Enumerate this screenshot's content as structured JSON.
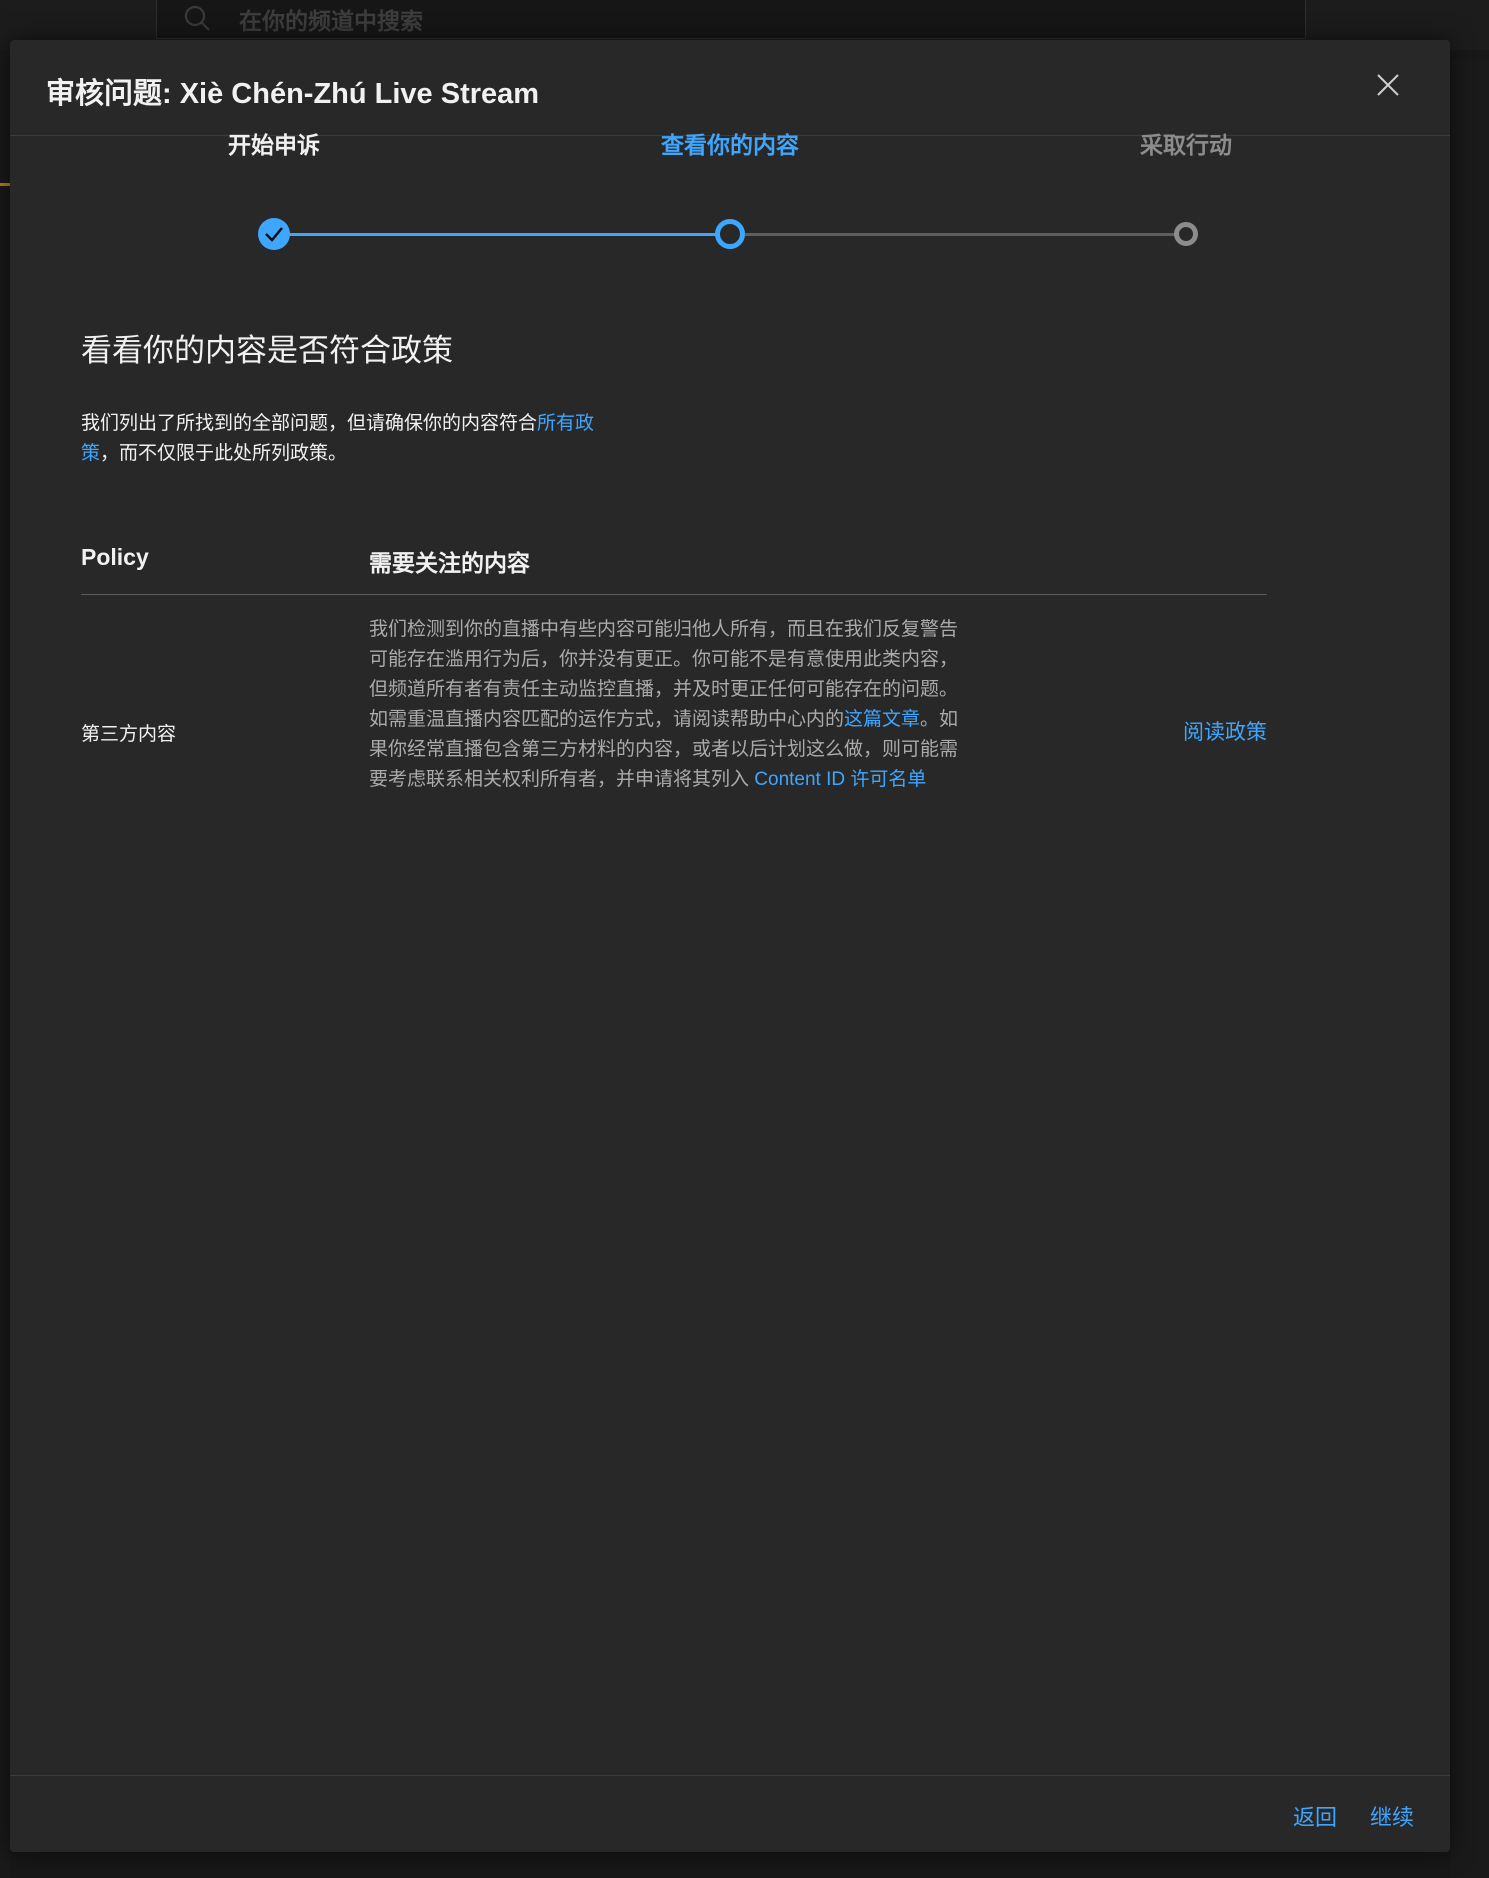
{
  "background": {
    "search_placeholder": "在你的频道中搜索"
  },
  "modal": {
    "title": "审核问题: Xiè Chén-Zhú Live Stream",
    "steps": [
      {
        "label": "开始申诉",
        "state": "done"
      },
      {
        "label": "查看你的内容",
        "state": "current"
      },
      {
        "label": "采取行动",
        "state": "todo"
      }
    ],
    "heading": "看看你的内容是否符合政策",
    "intro": {
      "before_link": "我们列出了所找到的全部问题，但请确保你的内容符合",
      "link": "所有政策",
      "after_link": "，而不仅限于此处所列政策。"
    },
    "table": {
      "col_policy": "Policy",
      "col_content": "需要关注的内容",
      "rows": [
        {
          "policy": "第三方内容",
          "text_part1": "我们检测到你的直播中有些内容可能归他人所有，而且在我们反复警告可能存在滥用行为后，你并没有更正。你可能不是有意使用此类内容，但频道所有者有责任主动监控直播，并及时更正任何可能存在的问题。如需重温直播内容匹配的运作方式，请阅读帮助中心内的",
          "link1": "这篇文章",
          "text_part2": "。如果你经常直播包含第三方材料的内容，或者以后计划这么做，则可能需要考虑联系相关权利所有者，并申请将其列入 ",
          "link2": "Content ID 许可名单",
          "action": "阅读政策"
        }
      ]
    },
    "footer": {
      "back": "返回",
      "continue": "继续"
    }
  },
  "colors": {
    "accent": "#3ea6ff",
    "modal_bg": "#282828",
    "text_primary": "#f1f1f1",
    "text_secondary": "#aaaaaa"
  }
}
